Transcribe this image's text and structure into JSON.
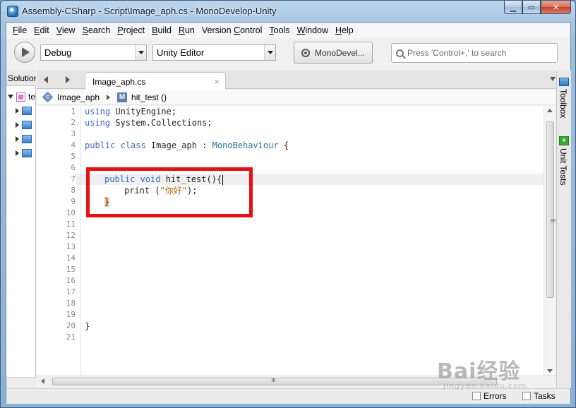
{
  "window": {
    "title": "Assembly-CSharp - Script\\Image_aph.cs - MonoDevelop-Unity"
  },
  "menu": [
    {
      "pre": "",
      "key": "F",
      "post": "ile"
    },
    {
      "pre": "",
      "key": "E",
      "post": "dit"
    },
    {
      "pre": "",
      "key": "V",
      "post": "iew"
    },
    {
      "pre": "",
      "key": "S",
      "post": "earch"
    },
    {
      "pre": "",
      "key": "P",
      "post": "roject"
    },
    {
      "pre": "",
      "key": "B",
      "post": "uild"
    },
    {
      "pre": "",
      "key": "R",
      "post": "un"
    },
    {
      "pre": "Version ",
      "key": "C",
      "post": "ontrol"
    },
    {
      "pre": "",
      "key": "T",
      "post": "ools"
    },
    {
      "pre": "",
      "key": "W",
      "post": "indow"
    },
    {
      "pre": "",
      "key": "H",
      "post": "elp"
    }
  ],
  "toolbar": {
    "config": "Debug",
    "target": "Unity Editor",
    "mono_button": "MonoDevel...",
    "search_placeholder": "Press 'Control+,' to search"
  },
  "solution": {
    "tab_label": "Solution",
    "root_label": "te"
  },
  "doc_tab": {
    "label": "Image_aph.cs",
    "close": "×"
  },
  "breadcrumb": {
    "class_name": "Image_aph",
    "method_name": "hit_test ()",
    "method_badge": "M",
    "class_badge": "C"
  },
  "editor": {
    "line_numbers": [
      "1",
      "2",
      "3",
      "4",
      "5",
      "6",
      "7",
      "8",
      "9",
      "10",
      "11",
      "12",
      "13",
      "14",
      "15",
      "16",
      "17",
      "18",
      "19",
      "20",
      "21"
    ],
    "lines": {
      "l1_kw": "using",
      "l1_rest": " UnityEngine;",
      "l2_kw": "using",
      "l2_rest": " System.Collections;",
      "l4_kw": "public class",
      "l4_name": " Image_aph : ",
      "l4_base": "MonoBehaviour",
      "l4_rest": " {",
      "l7_kw": "public void",
      "l7_rest": " hit_test(){",
      "l8_pre": "print (",
      "l8_str": "\"你好\"",
      "l8_post": ");",
      "l9": "}",
      "l20": "}"
    }
  },
  "right_pads": {
    "toolbox": "Toolbox",
    "unit_tests": "Unit Tests"
  },
  "status": {
    "errors": "Errors",
    "tasks": "Tasks"
  },
  "watermark": {
    "main": "Bai经验",
    "sub": "jingyan.baidu.com"
  },
  "colors": {
    "highlight_box": "#ea0f14",
    "keyword": "#3b68c7",
    "string": "#b56414"
  }
}
